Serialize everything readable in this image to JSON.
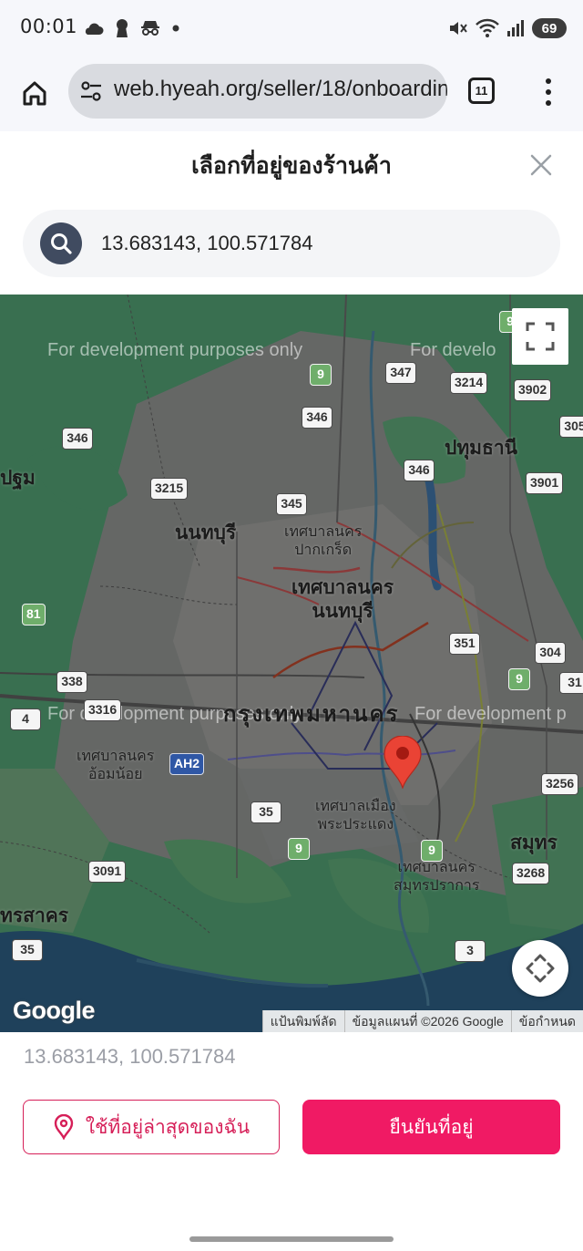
{
  "status_bar": {
    "time": "00:01",
    "battery": "69",
    "left_icons": [
      "cloud-icon",
      "keyhole-icon",
      "incognito-icon",
      "dot-icon"
    ],
    "right_icons": [
      "mute-icon",
      "wifi-icon",
      "signal-icon"
    ]
  },
  "browser": {
    "url": "web.hyeah.org/seller/18/onboarding",
    "tab_count": "11"
  },
  "modal": {
    "title": "เลือกที่อยู่ของร้านค้า"
  },
  "search": {
    "value": "13.683143, 100.571784",
    "placeholder": ""
  },
  "map": {
    "watermark": "For development purposes only",
    "watermark_cut": "For develo",
    "watermark_cut2": "For development p",
    "places": {
      "nonthaburi": "นนทบุรี",
      "pakkret": "เทศบาลนคร ปากเกร็ด",
      "pakkret_l1": "เทศบาลนคร",
      "pakkret_l2": "ปากเกร็ด",
      "nonthaburi_city_l1": "เทศบาลนคร",
      "nonthaburi_city_l2": "นนทบุรี",
      "bangkok": "กรุงเทพมหานคร",
      "pathum_thani": "ปทุมธานี",
      "nakhon_pathom_cut": "ปฐม",
      "om_noi_l1": "เทศบาลนคร",
      "om_noi_l2": "อ้อมน้อย",
      "phra_pradaeng_l1": "เทศบาลเมือง",
      "phra_pradaeng_l2": "พระประแดง",
      "samut_prakan_l1": "เทศบาลนคร",
      "samut_prakan_l2": "สมุทรปราการ",
      "samut_prakan_cut": "สมุทร",
      "samut_sakhon_cut": "ทรสาคร"
    },
    "shields": {
      "r347": "347",
      "r9a": "9",
      "r3214": "3214",
      "r3902": "3902",
      "r305": "305",
      "r346a": "346",
      "r346b": "346",
      "r346c": "346",
      "r3215": "3215",
      "r345": "345",
      "r3901": "3901",
      "r81": "81",
      "r351": "351",
      "r304": "304",
      "r9b": "9",
      "r31": "31",
      "r338": "338",
      "r3316": "3316",
      "r4": "4",
      "ah2": "AH2",
      "r3256": "3256",
      "r35a": "35",
      "r9c": "9",
      "r9d": "9",
      "r3091": "3091",
      "r3268": "3268",
      "r35b": "35",
      "r3": "3",
      "r9e": "9"
    },
    "google_logo": "Google",
    "attribution": {
      "shortcuts": "แป้นพิมพ์ลัด",
      "map_data": "ข้อมูลแผนที่ ©2026 Google",
      "terms": "ข้อกำหนด"
    },
    "pin_color": "#ea4335"
  },
  "coordinates_readout": "13.683143, 100.571784",
  "actions": {
    "use_current_location": "ใช้ที่อยู่ล่าสุดของฉัน",
    "confirm_address": "ยืนยันที่อยู่"
  },
  "colors": {
    "accent": "#f01a64",
    "accent_outline": "#d61f58",
    "search_icon_bg": "#404b60"
  }
}
